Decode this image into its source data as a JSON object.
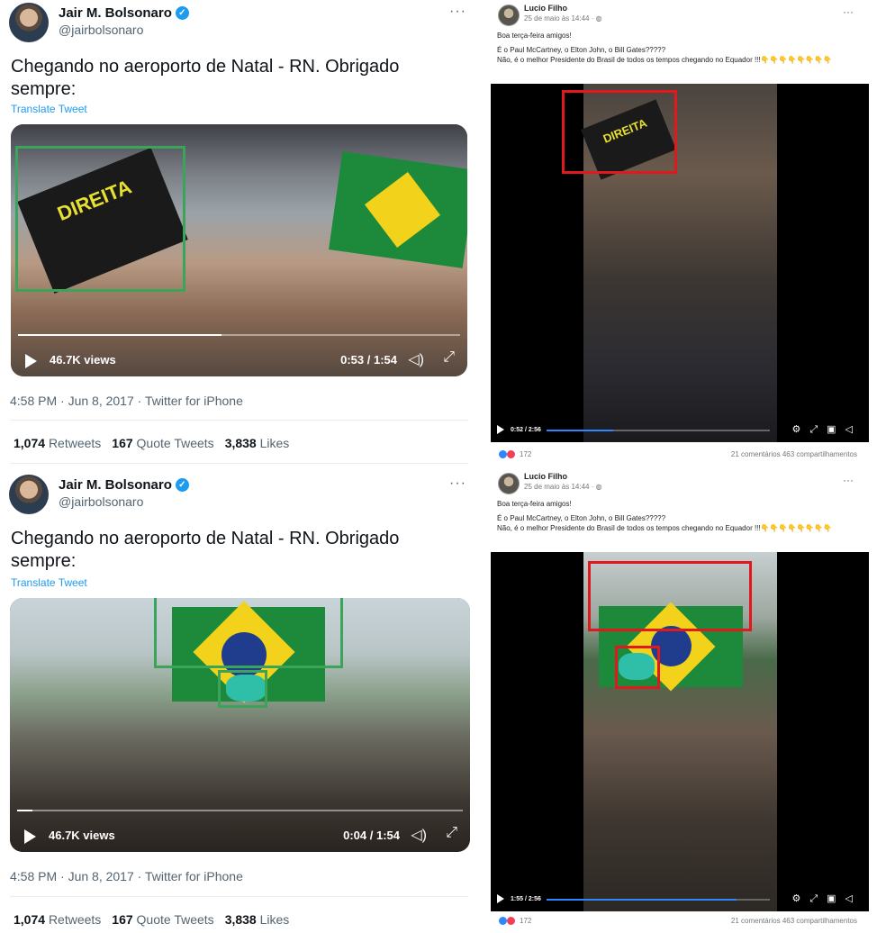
{
  "tweet1": {
    "name": "Jair M. Bolsonaro",
    "handle": "@jairbolsonaro",
    "more": "···",
    "text": "Chegando no aeroporto de Natal - RN. Obrigado sempre:",
    "translate": "Translate Tweet",
    "views": "46.7K views",
    "time": "0:53 / 1:54",
    "progress": 0.46,
    "sign_text": "DIREITA",
    "meta": "4:58 PM · Jun 8, 2017 · Twitter for iPhone",
    "retweets_count": "1,074",
    "retweets_label": "Retweets",
    "quotes_count": "167",
    "quotes_label": "Quote Tweets",
    "likes_count": "3,838",
    "likes_label": "Likes"
  },
  "tweet2": {
    "name": "Jair M. Bolsonaro",
    "handle": "@jairbolsonaro",
    "more": "···",
    "text": "Chegando no aeroporto de Natal - RN. Obrigado sempre:",
    "translate": "Translate Tweet",
    "views": "46.7K views",
    "time": "0:04 / 1:54",
    "progress": 0.035,
    "meta": "4:58 PM · Jun 8, 2017 · Twitter for iPhone",
    "retweets_count": "1,074",
    "retweets_label": "Retweets",
    "quotes_count": "167",
    "quotes_label": "Quote Tweets",
    "likes_count": "3,838",
    "likes_label": "Likes"
  },
  "fb1": {
    "name": "Lucio Filho",
    "date": "25 de maio às 14:44 · ",
    "more": "···",
    "line1": "Boa terça-feira amigos!",
    "line2": "É o Paul McCartney, o Elton John, o Bill Gates?????",
    "line3": "Não, é o melhor Presidente do Brasil de todos os tempos chegando no Equador !!!",
    "claps": "👇👇👇👇👇👇👇👇",
    "time": "0:52 / 2:56",
    "progress": 0.3,
    "sign_text": "DIREITA",
    "reactions": "172",
    "comments": "21 comentários",
    "shares": "463 compartilhamentos"
  },
  "fb2": {
    "name": "Lucio Filho",
    "date": "25 de maio às 14:44 · ",
    "more": "···",
    "line1": "Boa terça-feira amigos!",
    "line2": "É o Paul McCartney, o Elton John, o Bill Gates?????",
    "line3": "Não, é o melhor Presidente do Brasil de todos os tempos chegando no Equador !!!",
    "claps": "👇👇👇👇👇👇👇👇",
    "time": "1:55 / 2:56",
    "progress": 0.85,
    "reactions": "172",
    "comments": "21 comentários",
    "shares": "463 compartilhamentos"
  },
  "colors": {
    "twitter_blue": "#1d9bf0",
    "highlight_green": "#3aa55a",
    "highlight_red": "#e0191e",
    "flag_green": "#1c8a3a",
    "flag_yellow": "#f2d21a"
  }
}
